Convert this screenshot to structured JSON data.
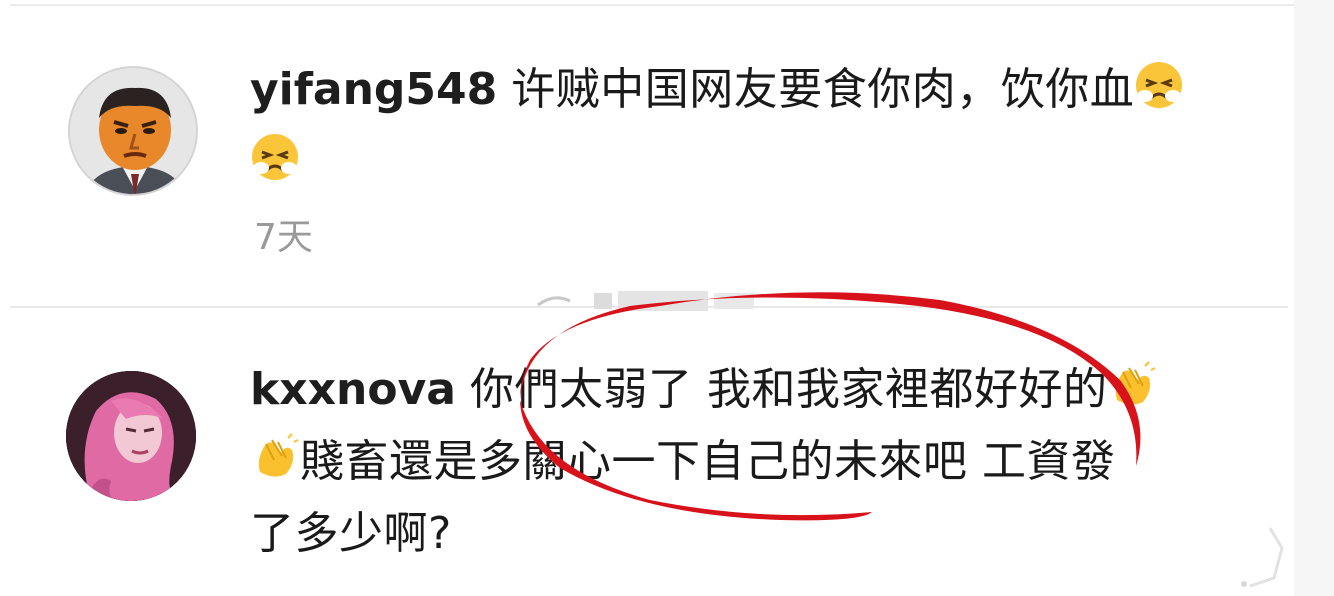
{
  "comments": [
    {
      "username": "yifang548",
      "lines": [
        "许贼中国网友要食你肉，饮你血",
        ""
      ],
      "emojis": [
        "persevering-face-emoji",
        "persevering-face-emoji"
      ],
      "time": "7天"
    },
    {
      "username": "kxxnova",
      "lines": [
        "你們太弱了 我和我家裡都好好的",
        "賤畜還是多關心一下自己的未來吧 工資發",
        "了多少啊?"
      ],
      "emojis": [
        "clapping-hands-emoji",
        "clapping-hands-emoji"
      ]
    }
  ],
  "colors": {
    "annotation": "#d7121b",
    "time": "#9a9a9a",
    "divider": "#e9e9e9"
  }
}
